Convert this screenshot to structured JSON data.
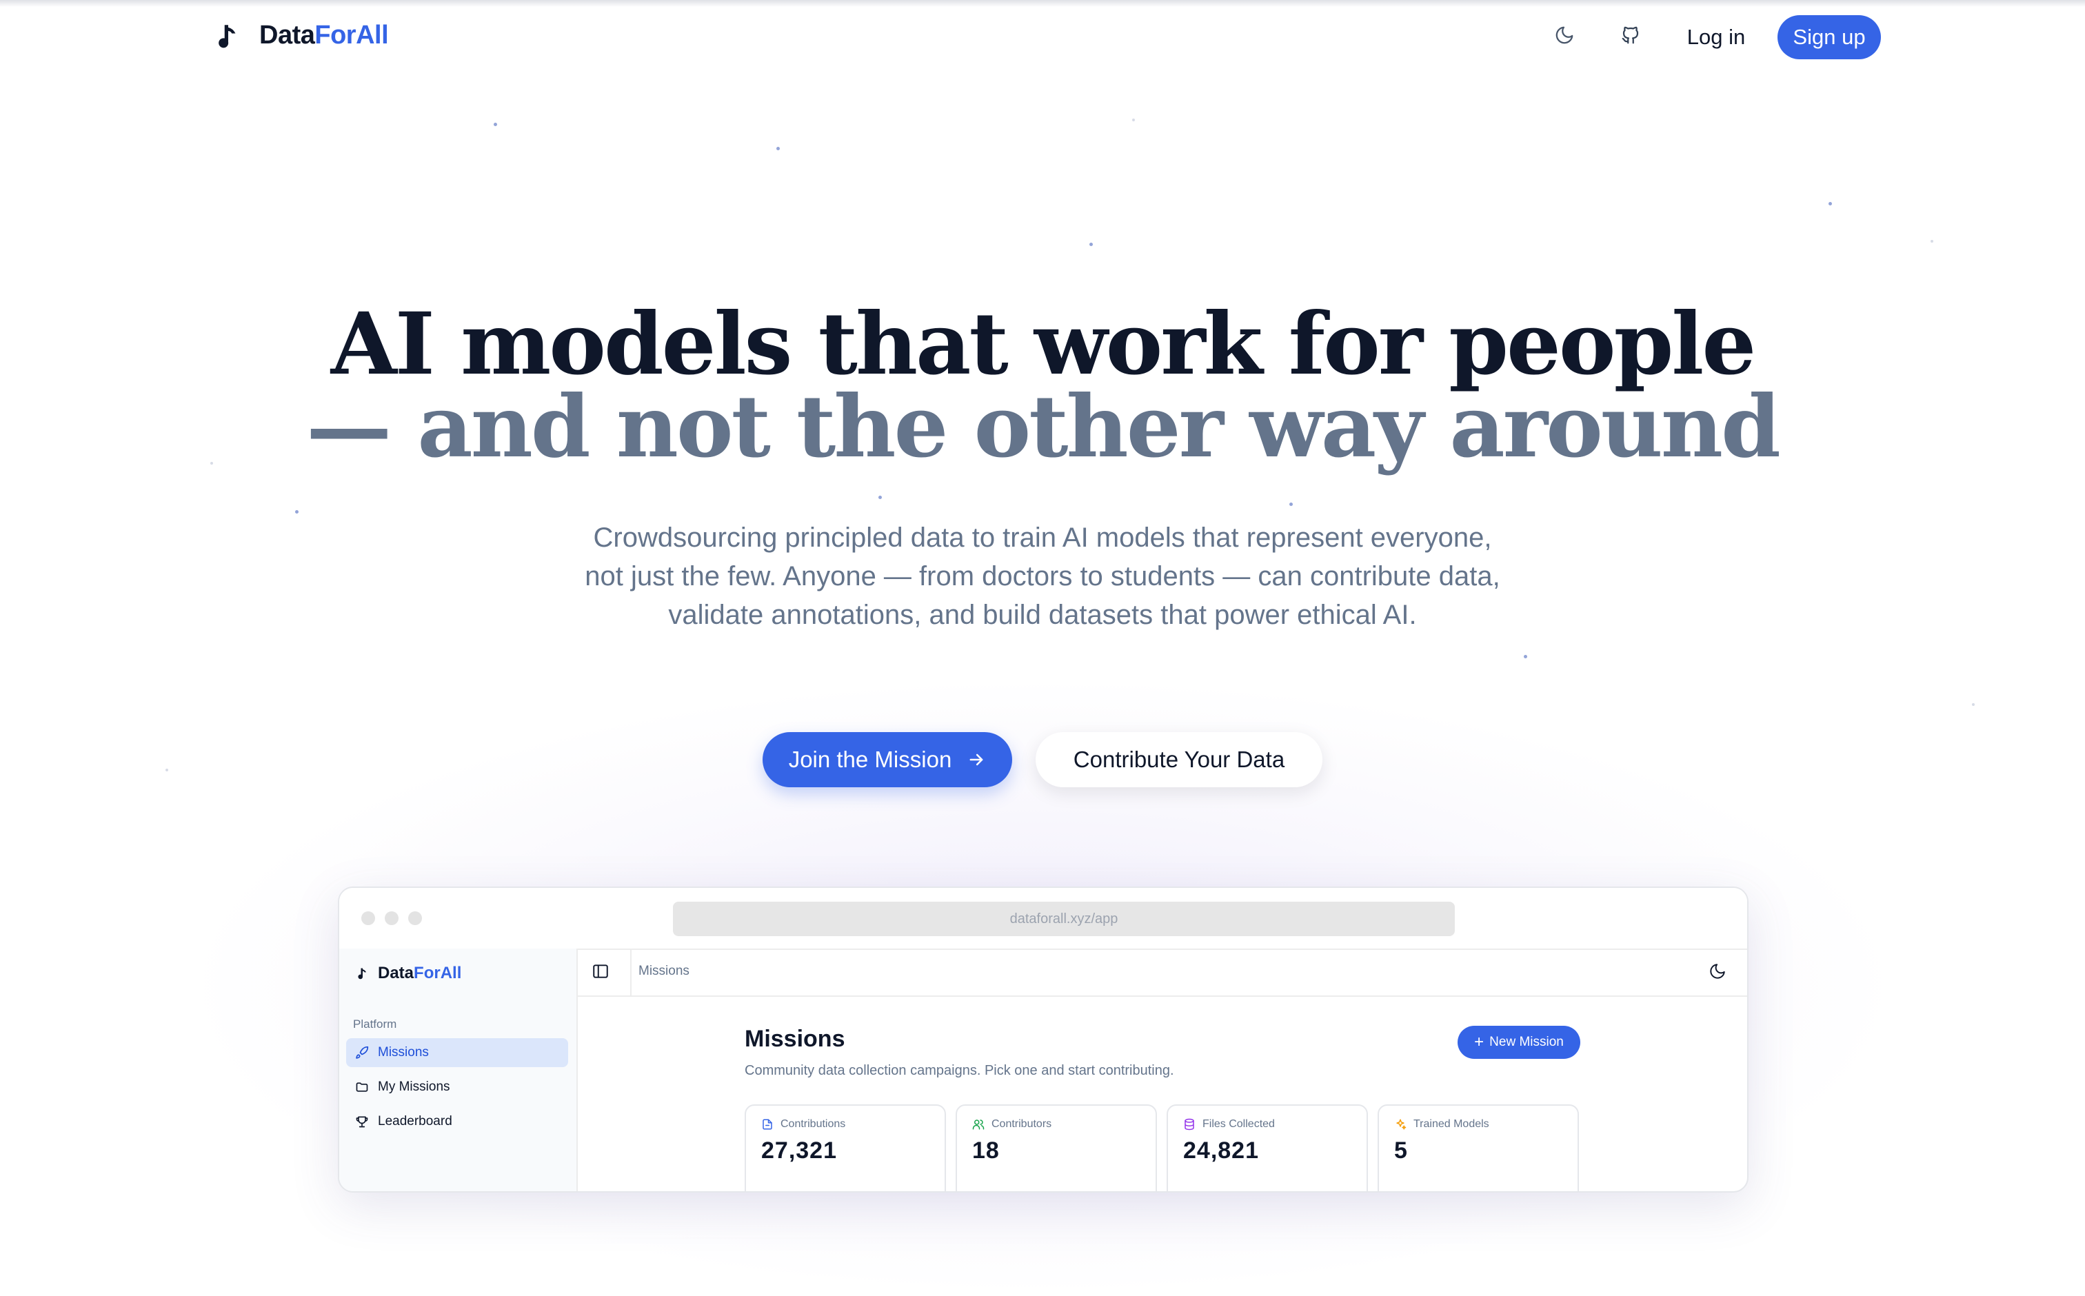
{
  "nav": {
    "logo_part1": "Data",
    "logo_part2": "ForAll",
    "theme_icon": "moon-icon",
    "github_icon": "github-icon",
    "login_label": "Log in",
    "signup_label": "Sign up"
  },
  "hero": {
    "title_line1": "AI models that work for people",
    "title_line2": "— and not the other way around",
    "subtitle": "Crowdsourcing principled data to train AI models that represent everyone, not just the few. Anyone — from doctors to students — can contribute data, validate annotations, and build datasets that power ethical AI.",
    "primary_cta": "Join the Mission",
    "secondary_cta": "Contribute Your Data"
  },
  "preview": {
    "url": "dataforall.xyz/app",
    "sidebar": {
      "logo_part1": "Data",
      "logo_part2": "ForAll",
      "section_label": "Platform",
      "items": [
        {
          "label": "Missions",
          "icon": "rocket-icon",
          "active": true
        },
        {
          "label": "My Missions",
          "icon": "folder-icon",
          "active": false
        },
        {
          "label": "Leaderboard",
          "icon": "trophy-icon",
          "active": false
        }
      ]
    },
    "breadcrumb": "Missions",
    "page_title": "Missions",
    "page_subtitle": "Community data collection campaigns. Pick one and start contributing.",
    "new_button": "New Mission",
    "stats": [
      {
        "label": "Contributions",
        "value": "27,321",
        "icon": "file-icon",
        "color": "#3564e6"
      },
      {
        "label": "Contributors",
        "value": "18",
        "icon": "users-icon",
        "color": "#16a34a"
      },
      {
        "label": "Files Collected",
        "value": "24,821",
        "icon": "database-icon",
        "color": "#9333ea"
      },
      {
        "label": "Trained Models",
        "value": "5",
        "icon": "sparkles-icon",
        "color": "#f59e0b"
      }
    ]
  },
  "colors": {
    "accent": "#3564e6",
    "heading": "#0f172a",
    "muted": "#64748b"
  }
}
